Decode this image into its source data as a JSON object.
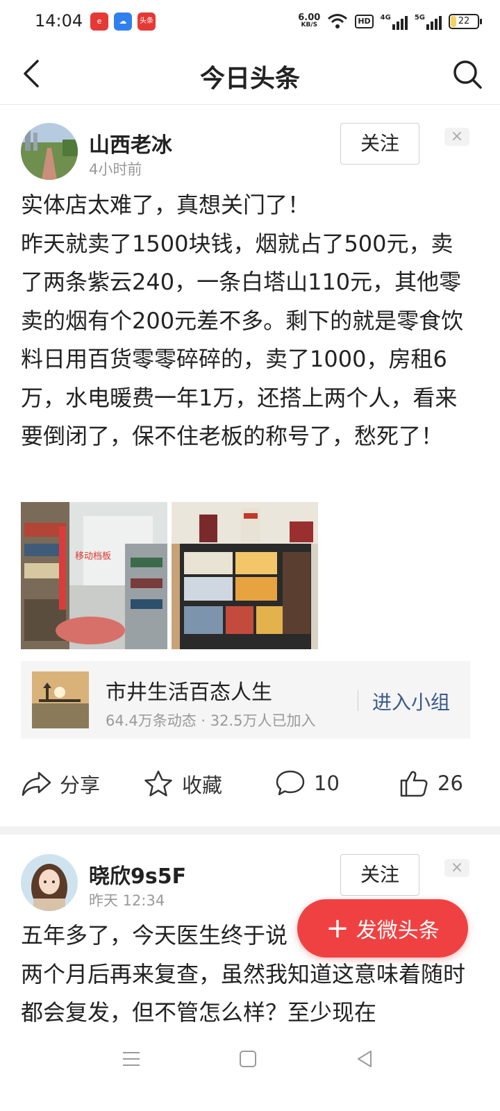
{
  "status_bar": {
    "time": "14:04",
    "app_icons": [
      "e-browser-icon",
      "cloud-app-icon",
      "toutiao-icon"
    ],
    "toutiao_label": "头条",
    "net_speed_value": "6.00",
    "net_speed_unit": "KB/S",
    "hd_label": "HD",
    "signal_4g": "4G",
    "signal_5g": "5G",
    "battery": "22",
    "battery_level": 0.22
  },
  "nav": {
    "title": "今日头条"
  },
  "posts": [
    {
      "author": "山西老冰",
      "time": "4小时前",
      "follow_label": "关注",
      "close_label": "×",
      "text": "实体店太难了，真想关门了！\n昨天就卖了1500块钱，烟就占了500元，卖了两条紫云240，一条白塔山110元，其他零卖的烟有个200元差不多。剩下的就是零食饮料日用百货零零碎碎的，卖了1000，房租6万，水电暖费一年1万，还搭上两个人，看来要倒闭了，保不住老板的称号了，愁死了！",
      "image_caption": "移动档板"
    },
    {
      "author": "晓欣9s5F",
      "time": "昨天  12:34",
      "follow_label": "关注",
      "close_label": "×",
      "text": "五年多了，今天医生终于说\n两个月后再来复查，虽然我知道这意味着随时都会复发，但不管怎么样？至少现在"
    }
  ],
  "group": {
    "name": "市井生活百态人生",
    "stats": "64.4万条动态 · 32.5万人已加入",
    "join_label": "进入小组"
  },
  "actions": {
    "share": "分享",
    "favorite": "收藏",
    "comments": "10",
    "likes": "26"
  },
  "fab": {
    "plus": "+",
    "label": "发微头条"
  },
  "colors": {
    "accent_red": "#f04142",
    "link_blue": "#3a5a8c",
    "secondary_text": "#999999"
  }
}
